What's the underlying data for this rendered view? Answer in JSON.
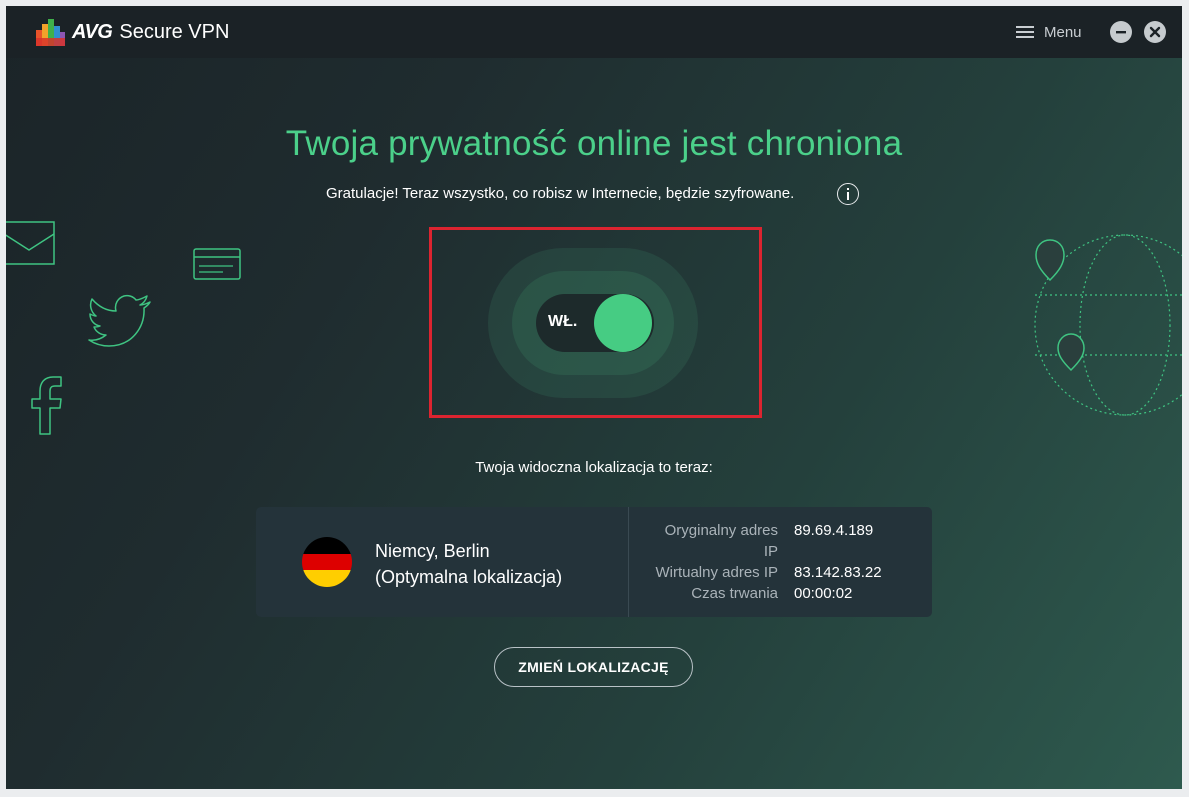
{
  "app": {
    "brand_avg": "AVG",
    "brand_product": "Secure VPN",
    "menu_label": "Menu"
  },
  "colors": {
    "accent": "#46cc83",
    "headline": "#4bd08a",
    "highlight_frame": "#dc2430"
  },
  "status": {
    "headline": "Twoja prywatność online jest chroniona",
    "subline": "Gratulacje! Teraz wszystko, co robisz w Internecie, będzie szyfrowane.",
    "toggle_label": "WŁ.",
    "toggle_on": true
  },
  "location": {
    "caption": "Twoja widoczna lokalizacja to teraz:",
    "country_city": "Niemcy, Berlin",
    "note": "(Optymalna lokalizacja)",
    "flag_colors": [
      "#000000",
      "#dd0000",
      "#ffce00"
    ]
  },
  "stats": {
    "original_ip_label_line1": "Oryginalny adres",
    "original_ip_label_line2": "IP",
    "original_ip": "89.69.4.189",
    "virtual_ip_label": "Wirtualny adres IP",
    "virtual_ip": "83.142.83.22",
    "duration_label": "Czas trwania",
    "duration": "00:00:02"
  },
  "actions": {
    "change_location": "ZMIEŃ LOKALIZACJĘ"
  },
  "icons": [
    "avg-logo-icon",
    "hamburger-icon",
    "minimize-icon",
    "close-icon",
    "info-icon",
    "mail-icon",
    "credit-card-icon",
    "twitter-icon",
    "facebook-icon",
    "globe-icon",
    "map-pin-icon"
  ]
}
